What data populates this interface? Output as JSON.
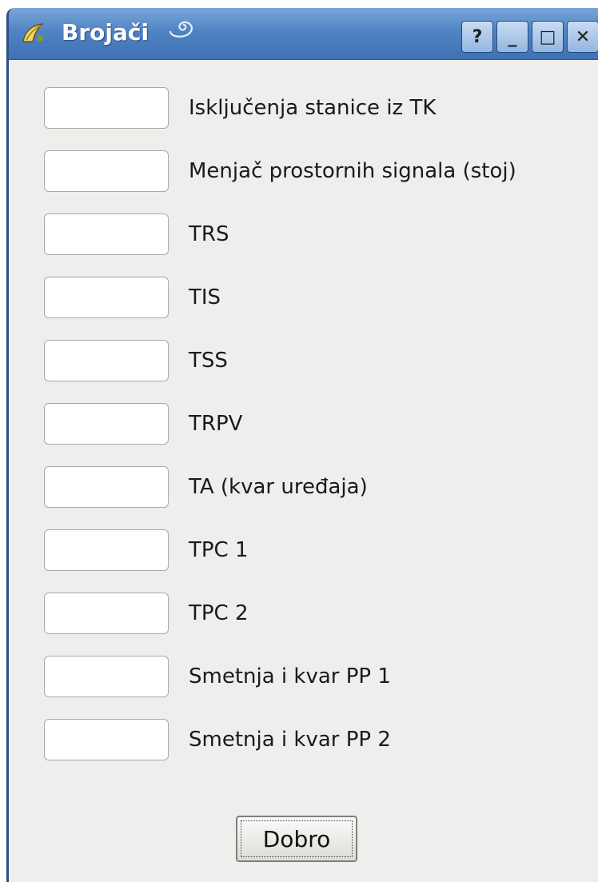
{
  "window": {
    "title": "Brojači",
    "controls": {
      "help": "?",
      "minimize": "_",
      "maximize": "□",
      "close": "✕"
    }
  },
  "fields": [
    {
      "label": "Isključenja stanice iz TK",
      "value": ""
    },
    {
      "label": "Menjač prostornih signala (stoj)",
      "value": ""
    },
    {
      "label": "TRS",
      "value": ""
    },
    {
      "label": "TIS",
      "value": ""
    },
    {
      "label": "TSS",
      "value": ""
    },
    {
      "label": "TRPV",
      "value": ""
    },
    {
      "label": "TA (kvar uređaja)",
      "value": ""
    },
    {
      "label": "TPC 1",
      "value": ""
    },
    {
      "label": "TPC 2",
      "value": ""
    },
    {
      "label": "Smetnja i kvar PP 1",
      "value": ""
    },
    {
      "label": "Smetnja i kvar PP 2",
      "value": ""
    }
  ],
  "buttons": {
    "ok_label": "Dobro"
  },
  "colors": {
    "titlebar": "#4f84c4",
    "window_bg": "#eeeeec",
    "border": "#2a4f86"
  }
}
